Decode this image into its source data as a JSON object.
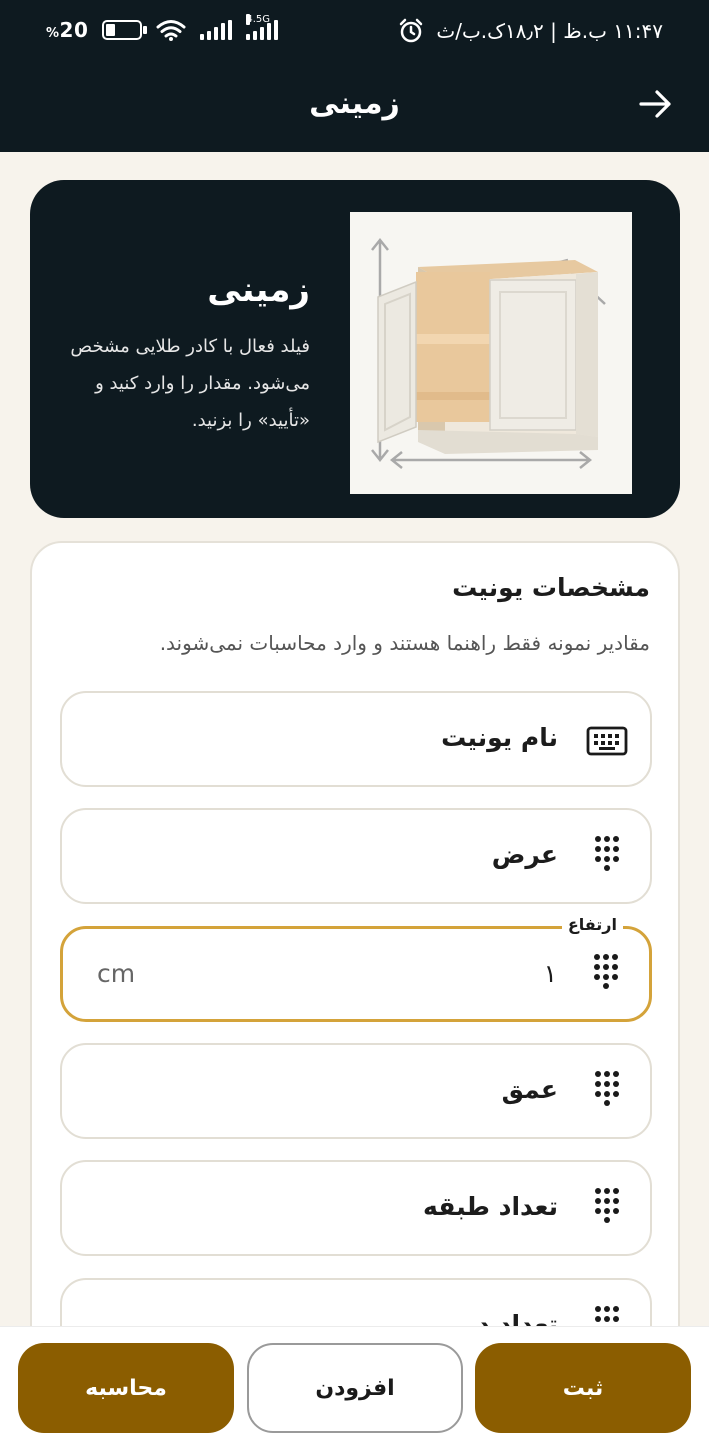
{
  "status_bar": {
    "battery": "20",
    "battery_percent_sign": "%",
    "network": "4.5G",
    "time": "۱۱:۴۷ ب.ظ | ۱۸٫۲ک.ب/ث"
  },
  "header": {
    "title": "زمینی"
  },
  "hero": {
    "title": "زمینی",
    "description": "فیلد فعال با کادر طلایی مشخص می‌شود. مقدار را وارد کنید و «تأیید» را بزنید."
  },
  "spec": {
    "title": "مشخصات یونیت",
    "hint": "مقادیر نمونه فقط راهنما هستند و وارد محاسبات نمی‌شوند.",
    "fields": [
      {
        "label": "نام یونیت",
        "icon": "keyboard-icon"
      },
      {
        "label": "عرض",
        "icon": "keypad-icon"
      },
      {
        "label": "ارتفاع",
        "value": "۱",
        "unit": "cm",
        "icon": "keypad-icon",
        "active": true
      },
      {
        "label": "عمق",
        "icon": "keypad-icon"
      },
      {
        "label": "تعداد طبقه",
        "icon": "keypad-icon"
      },
      {
        "label": "تعداد در",
        "icon": "keypad-icon"
      }
    ]
  },
  "actions": {
    "submit": "ثبت",
    "add": "افزودن",
    "calculate": "محاسبه"
  },
  "colors": {
    "dark": "#0e1a20",
    "accent": "#8b5d00",
    "active_border": "#d4a33a",
    "background": "#f7f3ec"
  }
}
